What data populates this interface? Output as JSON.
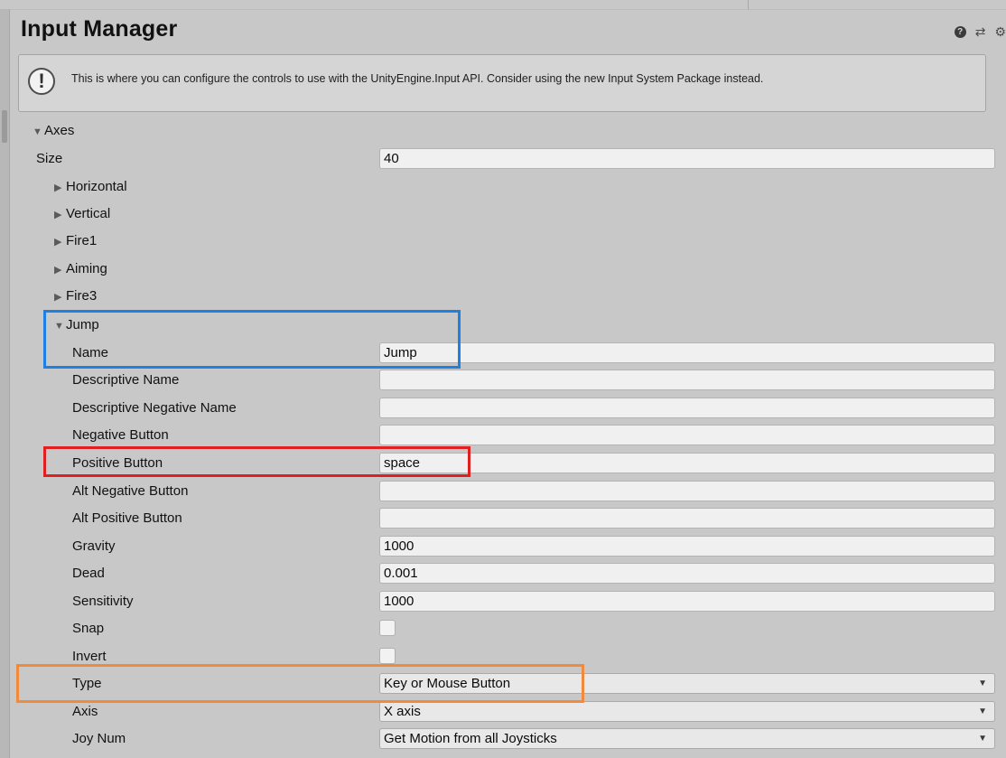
{
  "window": {
    "title": "Input Manager",
    "icons": [
      "help-icon",
      "preset-icon",
      "gear-icon"
    ]
  },
  "helpbox": {
    "text": "This is where you can configure the controls to use with the UnityEngine.Input API. Consider using the new Input System Package instead."
  },
  "axes": {
    "header": "Axes",
    "size_label": "Size",
    "size_value": "40",
    "collapsed": [
      "Horizontal",
      "Vertical",
      "Fire1",
      "Aiming",
      "Fire3"
    ],
    "jump": {
      "label": "Jump",
      "name_label": "Name",
      "name_value": "Jump",
      "descriptive_name_label": "Descriptive Name",
      "descriptive_name_value": "",
      "descriptive_negative_name_label": "Descriptive Negative Name",
      "descriptive_negative_name_value": "",
      "negative_button_label": "Negative Button",
      "negative_button_value": "",
      "positive_button_label": "Positive Button",
      "positive_button_value": "space",
      "alt_negative_button_label": "Alt Negative Button",
      "alt_negative_button_value": "",
      "alt_positive_button_label": "Alt Positive Button",
      "alt_positive_button_value": "",
      "gravity_label": "Gravity",
      "gravity_value": "1000",
      "dead_label": "Dead",
      "dead_value": "0.001",
      "sensitivity_label": "Sensitivity",
      "sensitivity_value": "1000",
      "snap_label": "Snap",
      "snap_checked": false,
      "invert_label": "Invert",
      "invert_checked": false,
      "type_label": "Type",
      "type_value": "Key or Mouse Button",
      "axis_label": "Axis",
      "axis_value": "X axis",
      "joy_num_label": "Joy Num",
      "joy_num_value": "Get Motion from all Joysticks"
    }
  },
  "highlights": {
    "blue": "#1e7fe6",
    "red": "#e02020",
    "orange": "#f18a3a"
  }
}
